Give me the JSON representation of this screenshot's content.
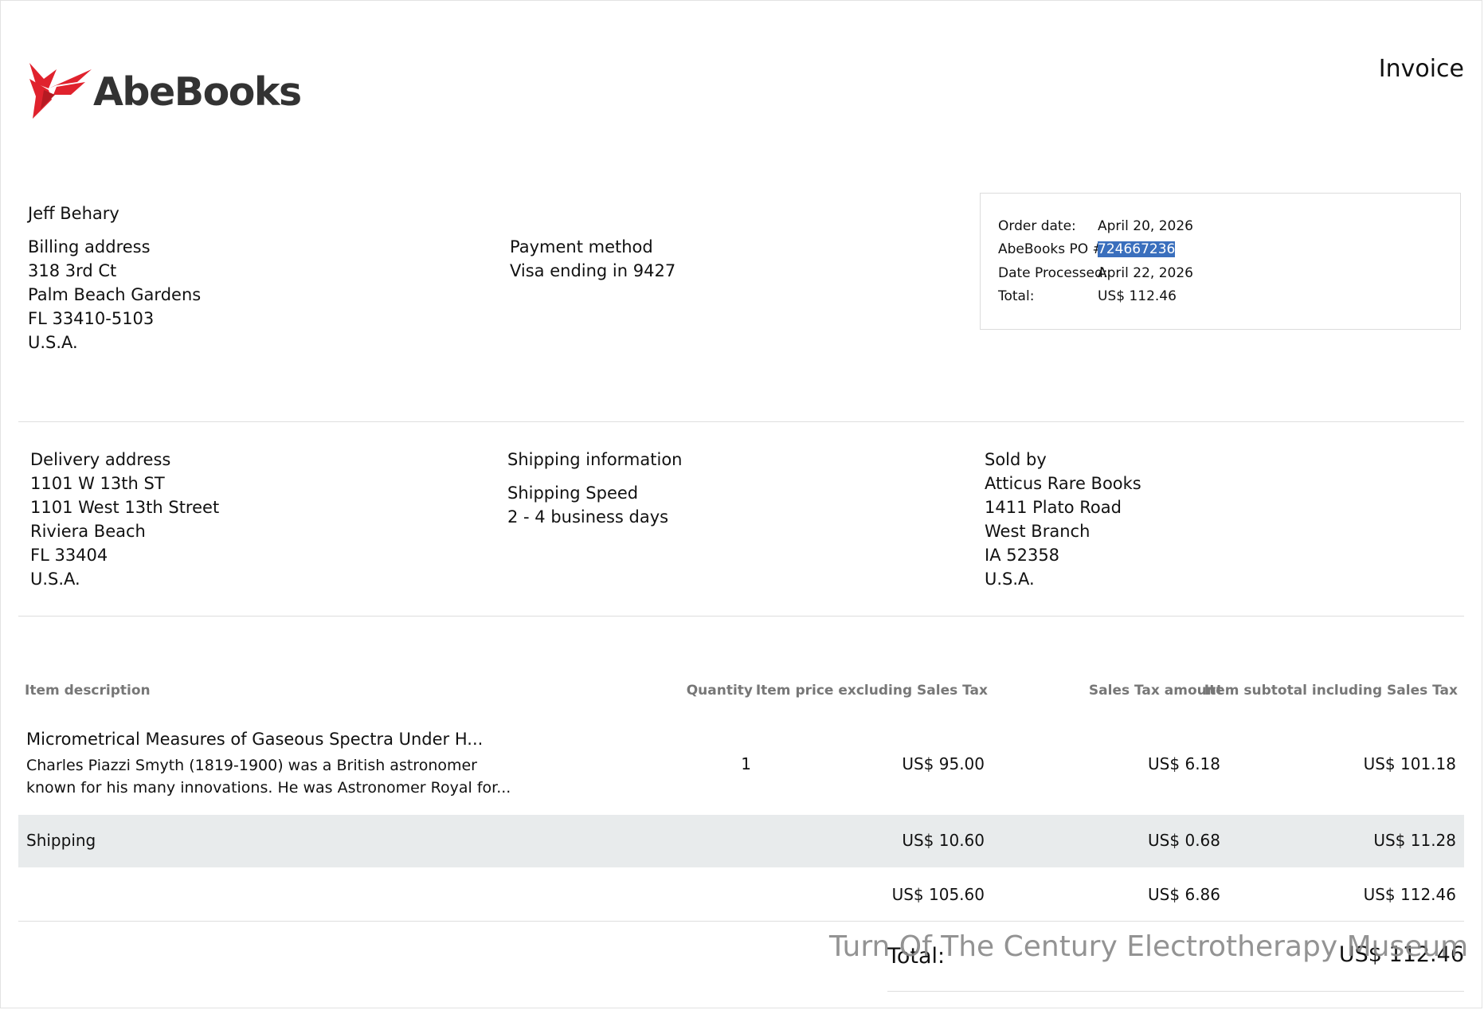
{
  "header": {
    "logo_text": "AbeBooks",
    "document_title": "Invoice"
  },
  "customer": {
    "name": "Jeff Behary"
  },
  "billing": {
    "heading": "Billing address",
    "lines": [
      "318 3rd Ct",
      "Palm Beach Gardens",
      "FL 33410-5103",
      "U.S.A."
    ]
  },
  "payment": {
    "heading": "Payment method",
    "value": "Visa ending in 9427"
  },
  "order_summary": {
    "rows": [
      {
        "label": "Order date:",
        "value": "April 20, 2026"
      },
      {
        "label": "AbeBooks PO #:",
        "value": "724667236"
      },
      {
        "label": "Date Processed:",
        "value": "April 22, 2026"
      },
      {
        "label": "Total:",
        "value": "US$ 112.46"
      }
    ]
  },
  "delivery": {
    "heading": "Delivery address",
    "lines": [
      "1101 W 13th ST",
      "1101 West 13th Street",
      "Riviera Beach",
      "FL 33404",
      "U.S.A."
    ]
  },
  "shipping_info": {
    "heading": "Shipping information",
    "speed_label": "Shipping Speed",
    "speed_value": "2 - 4 business days"
  },
  "seller": {
    "heading": "Sold by",
    "lines": [
      "Atticus Rare Books",
      "1411 Plato Road",
      "West Branch",
      "IA 52358",
      "U.S.A."
    ]
  },
  "table": {
    "headers": {
      "description": "Item description",
      "quantity": "Quantity",
      "price": "Item price excluding Sales Tax",
      "tax": "Sales Tax amount",
      "subtotal": "Item subtotal including Sales Tax"
    },
    "item": {
      "title": "Micrometrical Measures of Gaseous Spectra Under H...",
      "description": "Charles Piazzi Smyth (1819-1900) was a British astronomer known for his many innovations. He was Astronomer Royal for...",
      "quantity": "1",
      "price": "US$ 95.00",
      "tax": "US$ 6.18",
      "subtotal": "US$ 101.18"
    },
    "shipping": {
      "label": "Shipping",
      "price": "US$ 10.60",
      "tax": "US$ 0.68",
      "subtotal": "US$ 11.28"
    },
    "totals": {
      "price": "US$ 105.60",
      "tax": "US$ 6.86",
      "subtotal": "US$ 112.46"
    }
  },
  "grand_total": {
    "label": "Total:",
    "value": "US$ 112.46"
  },
  "watermark": "Turn Of The Century Electrotherapy Museum",
  "colors": {
    "brand_red": "#e0222d",
    "selection_blue": "#3a6fbd",
    "shipping_band": "#e8ebec"
  }
}
